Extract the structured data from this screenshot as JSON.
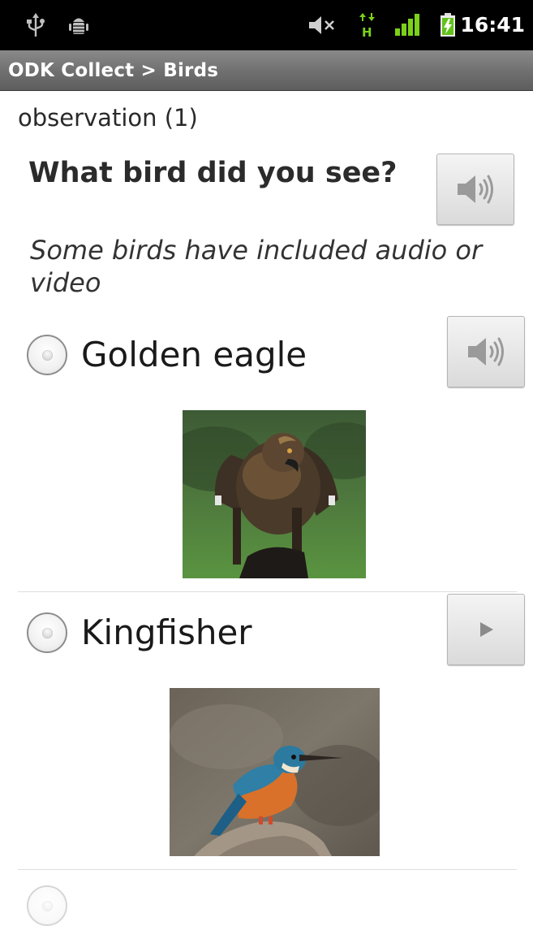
{
  "status_bar": {
    "icons": [
      "usb-icon",
      "android-debug-icon",
      "mute-icon",
      "hspa-data-icon",
      "signal-icon",
      "battery-charging-icon"
    ],
    "time": "16:41"
  },
  "title_bar": {
    "title": "ODK Collect > Birds"
  },
  "form": {
    "group_label": "observation (1)",
    "question": "What bird did you see?",
    "hint": "Some birds have included audio or video",
    "choices": [
      {
        "label": "Golden eagle",
        "media": "audio",
        "media_icon": "speaker-icon",
        "selected": false
      },
      {
        "label": "Kingfisher",
        "media": "video",
        "media_icon": "play-icon",
        "selected": false
      }
    ]
  },
  "colors": {
    "status_bar_bg": "#000000",
    "title_bar_bg": "#6f6f6f",
    "signal_green": "#7bd11a"
  }
}
